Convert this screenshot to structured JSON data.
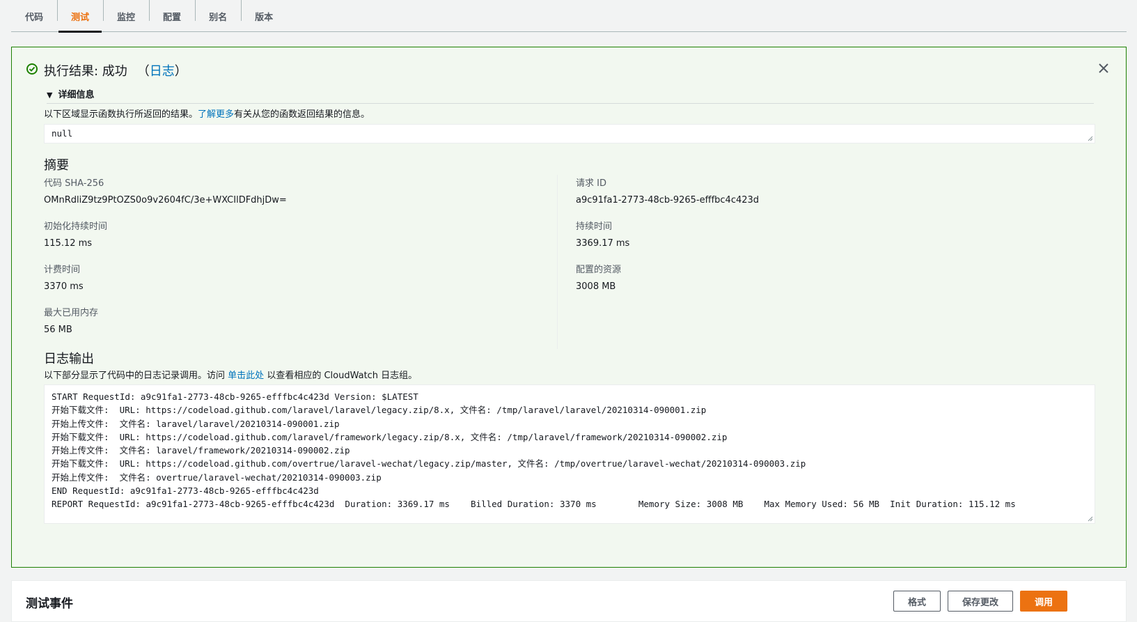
{
  "tabs": [
    {
      "label": "代码",
      "active": false
    },
    {
      "label": "测试",
      "active": true
    },
    {
      "label": "监控",
      "active": false
    },
    {
      "label": "配置",
      "active": false
    },
    {
      "label": "别名",
      "active": false
    },
    {
      "label": "版本",
      "active": false
    }
  ],
  "colors": {
    "success": "#1d8102",
    "accent": "#ec7211",
    "link": "#0073bb"
  },
  "result": {
    "icon": "check-circle-icon",
    "title": "执行结果: 成功",
    "log_open": "（",
    "log_link": "日志",
    "log_close": "）",
    "details_label": "详细信息",
    "desc_prefix": "以下区域显示函数执行所返回的结果。",
    "desc_link": "了解更多",
    "desc_suffix": "有关从您的函数返回结果的信息。",
    "return_value": "null"
  },
  "summary": {
    "title": "摘要",
    "left": [
      {
        "label": "代码 SHA-256",
        "value": "OMnRdliZ9tz9PtOZS0o9v2604fC/3e+WXCIlDFdhjDw="
      },
      {
        "label": "初始化持续时间",
        "value": "115.12 ms"
      },
      {
        "label": "计费时间",
        "value": "3370 ms"
      },
      {
        "label": "最大已用内存",
        "value": "56 MB"
      }
    ],
    "right": [
      {
        "label": "请求 ID",
        "value": "a9c91fa1-2773-48cb-9265-efffbc4c423d"
      },
      {
        "label": "持续时间",
        "value": "3369.17 ms"
      },
      {
        "label": "配置的资源",
        "value": "3008 MB"
      }
    ]
  },
  "log_output": {
    "title": "日志输出",
    "desc_prefix": "以下部分显示了代码中的日志记录调用。访问",
    "desc_link": "单击此处",
    "desc_suffix": "以查看相应的 CloudWatch 日志组。",
    "lines": [
      "START RequestId: a9c91fa1-2773-48cb-9265-efffbc4c423d Version: $LATEST",
      "开始下载文件:  URL: https://codeload.github.com/laravel/laravel/legacy.zip/8.x, 文件名: /tmp/laravel/laravel/20210314-090001.zip",
      "开始上传文件:  文件名: laravel/laravel/20210314-090001.zip",
      "开始下载文件:  URL: https://codeload.github.com/laravel/framework/legacy.zip/8.x, 文件名: /tmp/laravel/framework/20210314-090002.zip",
      "开始上传文件:  文件名: laravel/framework/20210314-090002.zip",
      "开始下载文件:  URL: https://codeload.github.com/overtrue/laravel-wechat/legacy.zip/master, 文件名: /tmp/overtrue/laravel-wechat/20210314-090003.zip",
      "开始上传文件:  文件名: overtrue/laravel-wechat/20210314-090003.zip",
      "END RequestId: a9c91fa1-2773-48cb-9265-efffbc4c423d",
      "REPORT RequestId: a9c91fa1-2773-48cb-9265-efffbc4c423d  Duration: 3369.17 ms    Billed Duration: 3370 ms        Memory Size: 3008 MB    Max Memory Used: 56 MB  Init Duration: 115.12 ms"
    ]
  },
  "test_event": {
    "title": "测试事件",
    "format_label": "格式",
    "save_label": "保存更改",
    "invoke_label": "调用"
  }
}
